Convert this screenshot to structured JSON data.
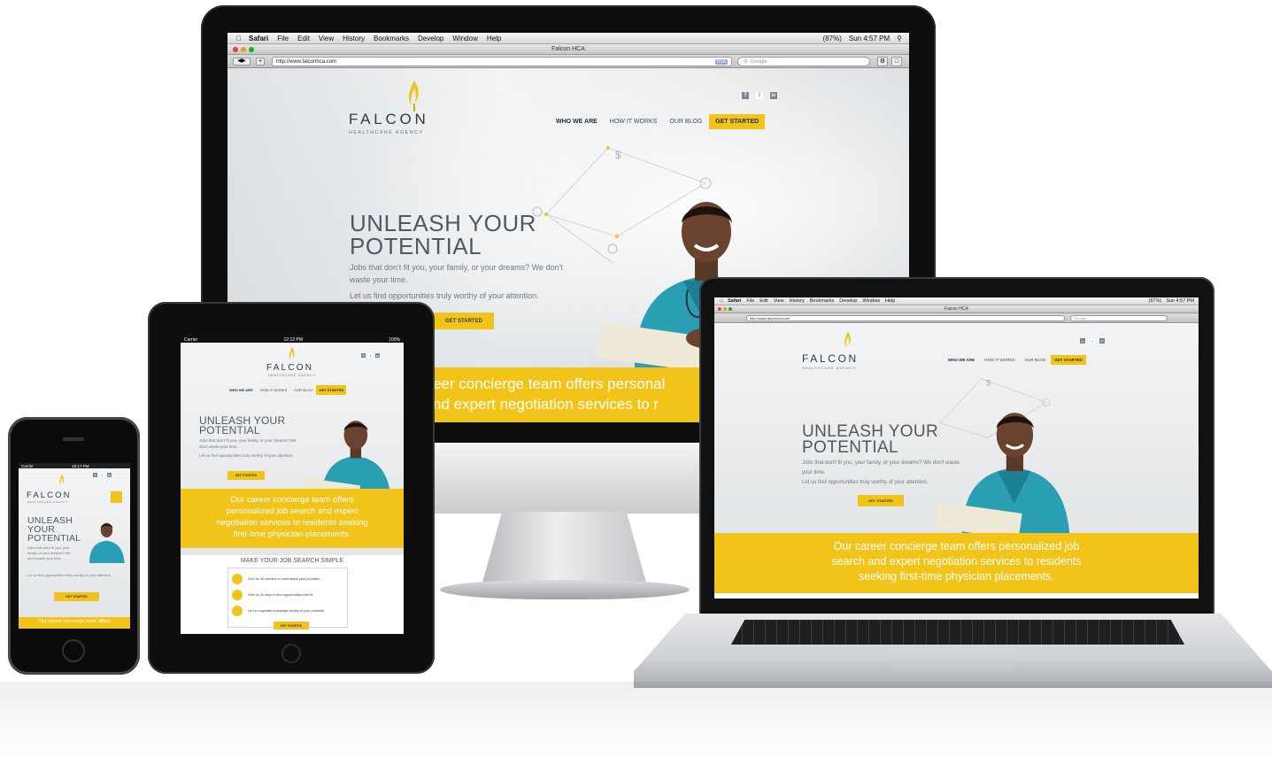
{
  "site": {
    "logo": "FALCON",
    "logo_sub": "HEALTHCARE AGENCY",
    "nav": [
      "WHO WE ARE",
      "HOW IT WORKS",
      "OUR BLOG",
      "GET STARTED"
    ],
    "social": [
      "f",
      "t",
      "in"
    ],
    "headline_1": "UNLEASH YOUR",
    "headline_2": "POTENTIAL",
    "headline_3": "YOUR",
    "intro": "Jobs that don't fit you, your family, or your dreams? We don't waste your time.",
    "intro_2": "Let us find opportunities truly worthy of your attention.",
    "cta": "GET STARTED",
    "band_full": "Our career concierge team offers personalized job search and expert negotiation services to residents seeking first-time physician placements.",
    "band_imac_1": "eer concierge team offers personal",
    "band_imac_2": "nd expert negotiation services to r",
    "band_laptop_1": "Our career concierge team offers personalized job",
    "band_laptop_2": "search and expert negotiation services to residents",
    "band_laptop_3": "seeking first-time physician placements.",
    "band_ipad_1": "Our career concierge team offers",
    "band_ipad_2": "personalized job search and expert",
    "band_ipad_3": "negotiation services to residents seeking",
    "band_ipad_4": "first-time physician placements.",
    "band_iphone": "Our career concierge team offers",
    "steps_title": "MAKE YOUR JOB SEARCH SIMPLE",
    "steps": [
      "Give us 30 minutes to understand your priorities.",
      "Give us 30 days to find opportunities that fit.",
      "Let us negotiate a package worthy of your potential."
    ]
  },
  "browser": {
    "app": "Safari",
    "menu": [
      "File",
      "Edit",
      "View",
      "History",
      "Bookmarks",
      "Develop",
      "Window",
      "Help"
    ],
    "clock": "Sun 4:57 PM",
    "battery": "(87%)",
    "title": "Falcon HCA",
    "url": "http://www.falconhca.com",
    "search_placeholder": "Google",
    "rss": "RSS"
  },
  "ipad_status": {
    "carrier": "Carrier",
    "time": "12:12 PM",
    "battery": "100%"
  },
  "iphone_status": {
    "carrier": "Carrier",
    "time": "10:17 PM"
  },
  "colors": {
    "accent": "#f2c318",
    "text": "#4d5a64",
    "frame": "#0d0d0d"
  }
}
